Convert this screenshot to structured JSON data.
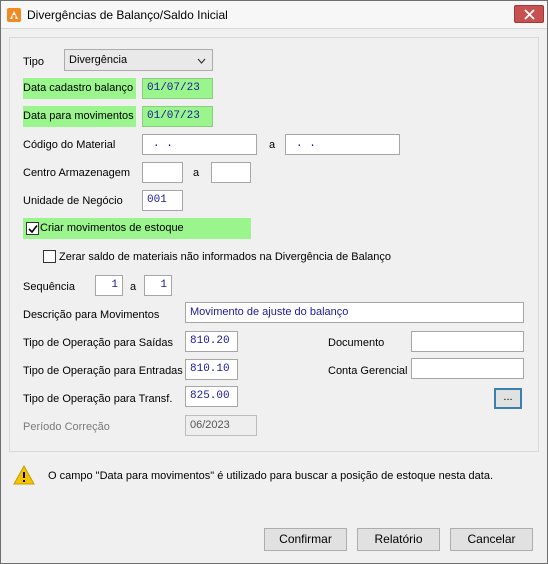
{
  "window": {
    "title": "Divergências de Balanço/Saldo Inicial",
    "close_label": "✕"
  },
  "form": {
    "tipo_label": "Tipo",
    "tipo_value": "Divergência",
    "data_cadastro_label": "Data cadastro balanço",
    "data_cadastro_value": "01/07/23",
    "data_mov_label": "Data para movimentos",
    "data_mov_value": "01/07/23",
    "codigo_material_label": "Código do Material",
    "codigo_material_from": ". .",
    "codigo_material_to": ". .",
    "a_label": "a",
    "centro_label": "Centro Armazenagem",
    "centro_from": "",
    "centro_to": "",
    "unidade_label": "Unidade de Negócio",
    "unidade_value": "001",
    "criar_mov_label": "Criar movimentos de estoque",
    "criar_mov_checked": true,
    "zerar_label": "Zerar saldo de materiais não informados na Divergência de Balanço",
    "zerar_checked": false,
    "sequencia_label": "Sequência",
    "sequencia_from": "1",
    "sequencia_to": "1",
    "descricao_label": "Descrição para Movimentos",
    "descricao_value": "Movimento de ajuste do balanço",
    "op_saidas_label": "Tipo de Operação para Saídas",
    "op_saidas_value": "810.20",
    "op_entradas_label": "Tipo de Operação para Entradas",
    "op_entradas_value": "810.10",
    "op_transf_label": "Tipo de Operação para Transf.",
    "op_transf_value": "825.00",
    "documento_label": "Documento",
    "documento_value": "",
    "conta_label": "Conta Gerencial",
    "conta_value": "",
    "ellipsis_label": "...",
    "periodo_label": "Período Correção",
    "periodo_value": "06/2023"
  },
  "info": {
    "message": "O campo \"Data para movimentos\" é utilizado para buscar a posição de estoque nesta data."
  },
  "buttons": {
    "confirmar": "Confirmar",
    "relatorio": "Relatório",
    "cancelar": "Cancelar"
  },
  "colors": {
    "highlight": "#9af58c",
    "field_text": "#1a1a9a",
    "close_red": "#c75050",
    "warning": "#f5c400"
  },
  "icons": {
    "title": "app-icon",
    "close": "close-icon",
    "dropdown": "chevron-down-icon",
    "check": "check-icon",
    "warning": "warning-icon"
  }
}
